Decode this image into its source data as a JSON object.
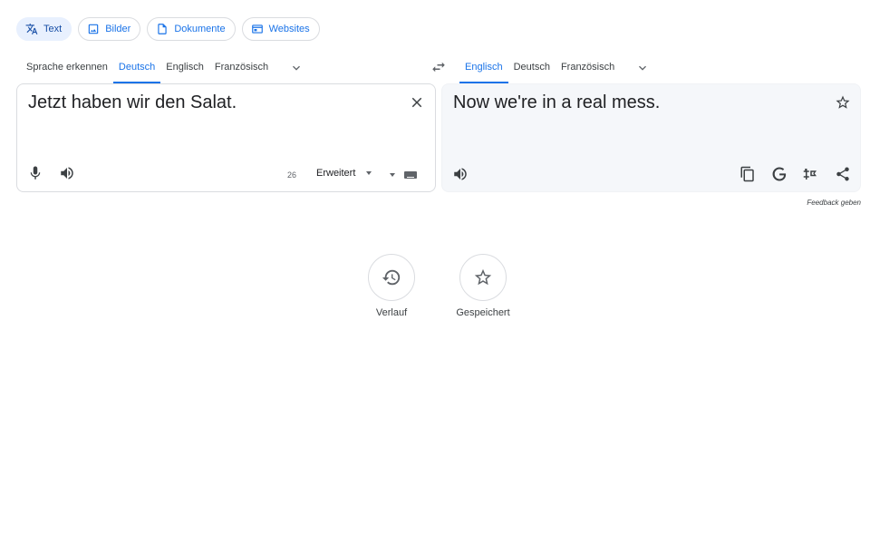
{
  "modes": {
    "text": "Text",
    "images": "Bilder",
    "documents": "Dokumente",
    "websites": "Websites"
  },
  "source_langs": {
    "detect": "Sprache erkennen",
    "german": "Deutsch",
    "english": "Englisch",
    "french": "Französisch"
  },
  "target_langs": {
    "english": "Englisch",
    "german": "Deutsch",
    "french": "Französisch"
  },
  "source": {
    "text": "Jetzt haben wir den Salat.",
    "char_count": "26",
    "mode_dropdown": "Erweitert"
  },
  "target": {
    "text": "Now we're in a real mess."
  },
  "feedback_label": "Feedback geben",
  "history_label": "Verlauf",
  "saved_label": "Gespeichert",
  "colors": {
    "accent": "#1a73e8",
    "active_chip_bg": "#e8f0fe",
    "target_panel_bg": "#f5f7fa"
  },
  "icons": {
    "text_mode": "translate-icon",
    "images_mode": "image-icon",
    "documents_mode": "document-icon",
    "websites_mode": "web-icon",
    "swap": "swap-languages-icon",
    "clear": "close-icon",
    "star": "star-icon",
    "mic": "microphone-icon",
    "listen": "speaker-icon",
    "copy": "copy-icon",
    "google": "google-icon",
    "alternatives": "alternatives-icon",
    "share": "share-icon",
    "keyboard": "keyboard-icon",
    "history": "history-icon"
  }
}
